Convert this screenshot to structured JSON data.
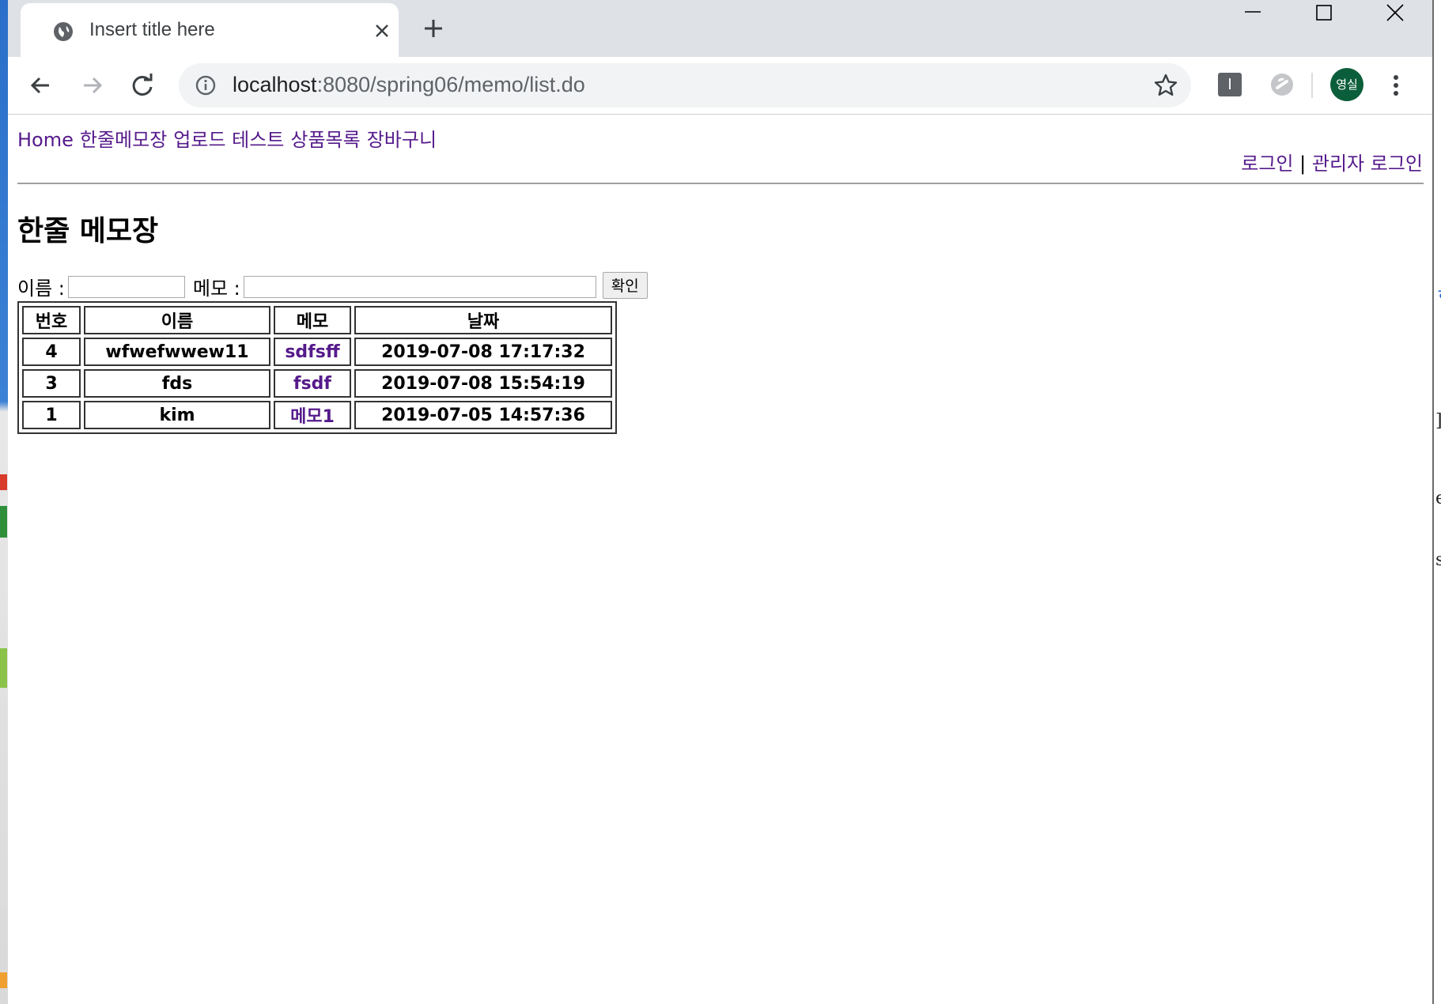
{
  "browser": {
    "tab": {
      "title": "Insert title here"
    },
    "address_bar": {
      "host": "localhost",
      "path": ":8080/spring06/memo/list.do"
    },
    "profile": {
      "avatar_label": "영실",
      "avatar_color": "#0b5e3a"
    },
    "extensions": {
      "ext1_label": "I"
    }
  },
  "page": {
    "nav_menu": [
      "Home",
      "한줄메모장",
      "업로드 테스트",
      "상품목록",
      "장바구니"
    ],
    "login_links": {
      "login": "로그인",
      "separator": "|",
      "admin_login": "관리자 로그인"
    },
    "title": "한줄 메모장",
    "form": {
      "name_label": "이름 :",
      "name_value": "",
      "memo_label": "메모 :",
      "memo_value": "",
      "submit_label": "확인"
    },
    "table": {
      "headers": [
        "번호",
        "이름",
        "메모",
        "날짜"
      ],
      "rows": [
        {
          "no": "4",
          "name": "wfwefwwew11",
          "memo": "sdfsff",
          "date": "2019-07-08 17:17:32"
        },
        {
          "no": "3",
          "name": "fds",
          "memo": "fsdf",
          "date": "2019-07-08 15:54:19"
        },
        {
          "no": "1",
          "name": "kim",
          "memo": "메모1",
          "date": "2019-07-05 14:57:36"
        }
      ]
    }
  },
  "colors": {
    "link_visited": "#551a8b",
    "titlebar": "#dee1e6"
  }
}
